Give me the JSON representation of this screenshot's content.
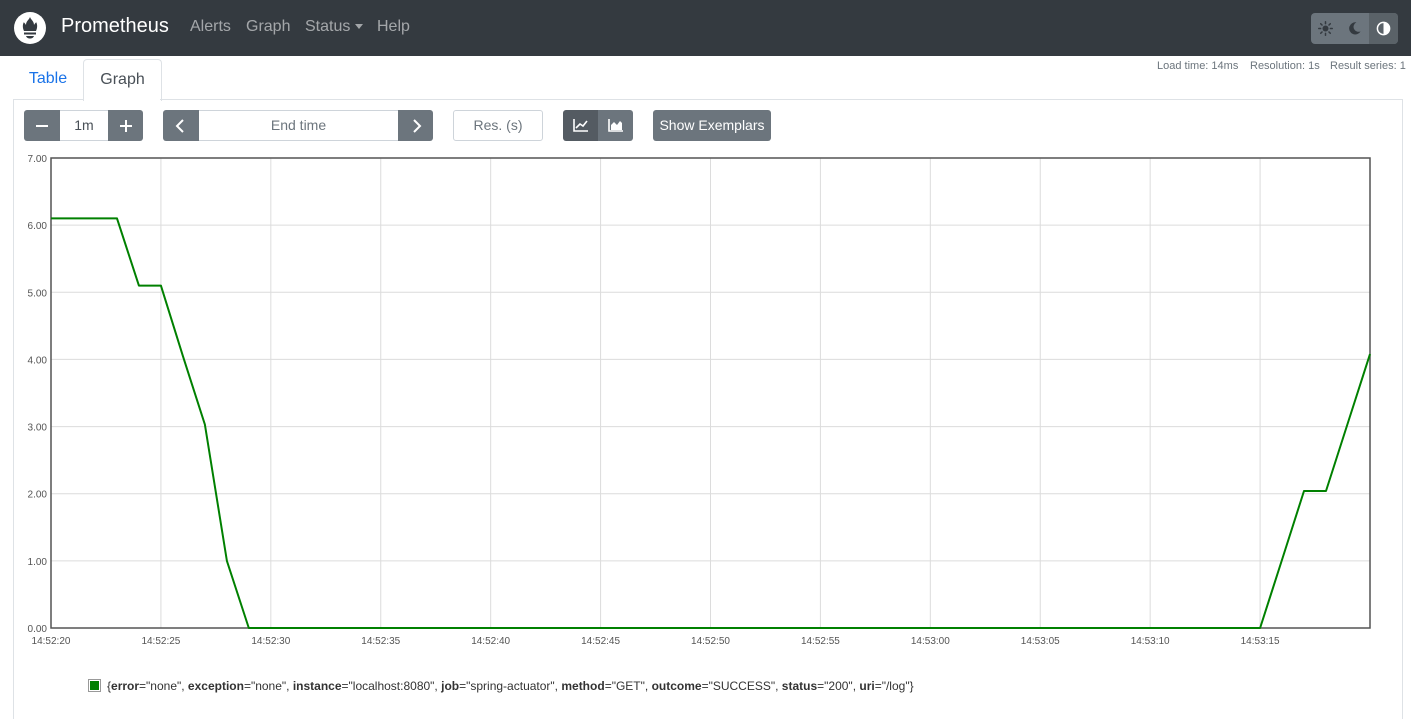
{
  "navbar": {
    "brand": "Prometheus",
    "links": [
      "Alerts",
      "Graph",
      "Status",
      "Help"
    ],
    "theme_icons": [
      "sun-icon",
      "moon-icon",
      "contrast-icon"
    ]
  },
  "tabs": [
    "Table",
    "Graph"
  ],
  "stats": {
    "load_time": "Load time: 14ms",
    "resolution": "Resolution: 1s",
    "result_series": "Result series: 1"
  },
  "controls": {
    "range_value": "1m",
    "end_time_placeholder": "End time",
    "resolution_placeholder": "Res. (s)",
    "exemplars_label": "Show Exemplars"
  },
  "colors": {
    "navbar_bg": "#343a40",
    "series": "#008000",
    "button_bg": "#6c757d"
  },
  "chart_data": {
    "type": "line",
    "ylim": [
      0,
      7
    ],
    "yticks": [
      "0.00",
      "1.00",
      "2.00",
      "3.00",
      "4.00",
      "5.00",
      "6.00",
      "7.00"
    ],
    "xlim": [
      0,
      60
    ],
    "xticks": [
      "14:52:20",
      "14:52:25",
      "14:52:30",
      "14:52:35",
      "14:52:40",
      "14:52:45",
      "14:52:50",
      "14:52:55",
      "14:53:00",
      "14:53:05",
      "14:53:10",
      "14:53:15"
    ],
    "grid": true,
    "legend_position": "bottom-left",
    "series": [
      {
        "x": [
          0,
          1,
          2,
          3,
          4,
          5,
          6,
          7,
          8,
          9,
          10,
          11,
          12,
          13,
          14,
          15,
          16,
          17,
          18,
          19,
          20,
          21,
          22,
          23,
          24,
          25,
          26,
          27,
          28,
          29,
          30,
          31,
          32,
          33,
          34,
          35,
          36,
          37,
          38,
          39,
          40,
          41,
          42,
          43,
          44,
          45,
          46,
          47,
          48,
          49,
          50,
          51,
          52,
          53,
          54,
          55,
          56,
          57,
          58,
          59,
          60
        ],
        "values": [
          6.1,
          6.1,
          6.1,
          6.1,
          5.1,
          5.1,
          4.05,
          3.03,
          1.0,
          0,
          0,
          0,
          0,
          0,
          0,
          0,
          0,
          0,
          0,
          0,
          0,
          0,
          0,
          0,
          0,
          0,
          0,
          0,
          0,
          0,
          0,
          0,
          0,
          0,
          0,
          0,
          0,
          0,
          0,
          0,
          0,
          0,
          0,
          0,
          0,
          0,
          0,
          0,
          0,
          0,
          0,
          0,
          0,
          0,
          0,
          0,
          1.02,
          2.04,
          2.04,
          3.06,
          4.08
        ]
      }
    ]
  },
  "legend": {
    "open": "{",
    "close": "}",
    "labels": [
      {
        "key": "error",
        "value": "\"none\"",
        "sep": ", "
      },
      {
        "key": "exception",
        "value": "\"none\"",
        "sep": ", "
      },
      {
        "key": "instance",
        "value": "\"localhost:8080\"",
        "sep": ", "
      },
      {
        "key": "job",
        "value": "\"spring-actuator\"",
        "sep": ", "
      },
      {
        "key": "method",
        "value": "\"GET\"",
        "sep": ", "
      },
      {
        "key": "outcome",
        "value": "\"SUCCESS\"",
        "sep": ", "
      },
      {
        "key": "status",
        "value": "\"200\"",
        "sep": ", "
      },
      {
        "key": "uri",
        "value": "\"/log\"",
        "sep": ""
      }
    ]
  }
}
